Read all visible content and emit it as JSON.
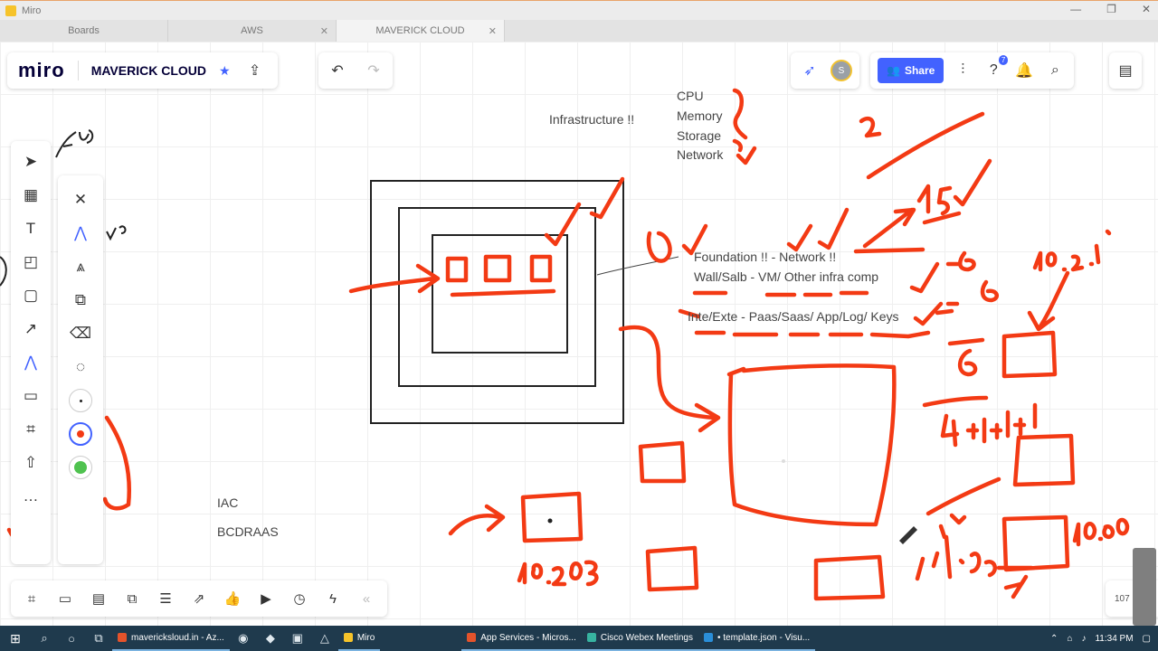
{
  "window": {
    "title": "Miro",
    "controls": [
      "—",
      "❐",
      "✕"
    ]
  },
  "tabs": [
    {
      "label": "Boards",
      "active": false
    },
    {
      "label": "AWS",
      "active": false,
      "close": "✕"
    },
    {
      "label": "MAVERICK CLOUD",
      "active": true,
      "close": "✕"
    }
  ],
  "header": {
    "logo": "miro",
    "board_name": "MAVERICK CLOUD",
    "star": "★",
    "share_label": "Share",
    "notification_badge": "7",
    "avatar_initial": "S"
  },
  "board": {
    "infra_label": "Infrastructure !!",
    "resources": [
      "CPU",
      "Memory",
      "Storage",
      "Network"
    ],
    "foundation_text": "Foundation !! - Network !!",
    "wall_text": "Wall/Salb  - VM/ Other infra comp",
    "inte_text": "Inte/Exte -  Paas/Saas/ App/Log/ Keys",
    "iac_label": "IAC",
    "bcdraas_label": "BCDRAAS",
    "ink_notes": [
      "2",
      "15",
      "10.2.1",
      "-6",
      "-6",
      "6",
      "4+1+1+1",
      "10.209",
      "10.60",
      "1.1.5.0",
      "1"
    ],
    "ink_color": "#f33a14"
  },
  "zoom": "107",
  "taskbar": {
    "tasks": [
      {
        "label": "mavericksloud.in - Az...",
        "color": "#e4532b"
      },
      {
        "label": "Miro",
        "color": "#f6c32a"
      },
      {
        "label": "App Services - Micros...",
        "color": "#e4532b"
      },
      {
        "label": "Cisco Webex Meetings",
        "color": "#37b3a0"
      },
      {
        "label": "• template.json - Visu...",
        "color": "#2a8ed8"
      }
    ],
    "time": "11:34 PM"
  }
}
